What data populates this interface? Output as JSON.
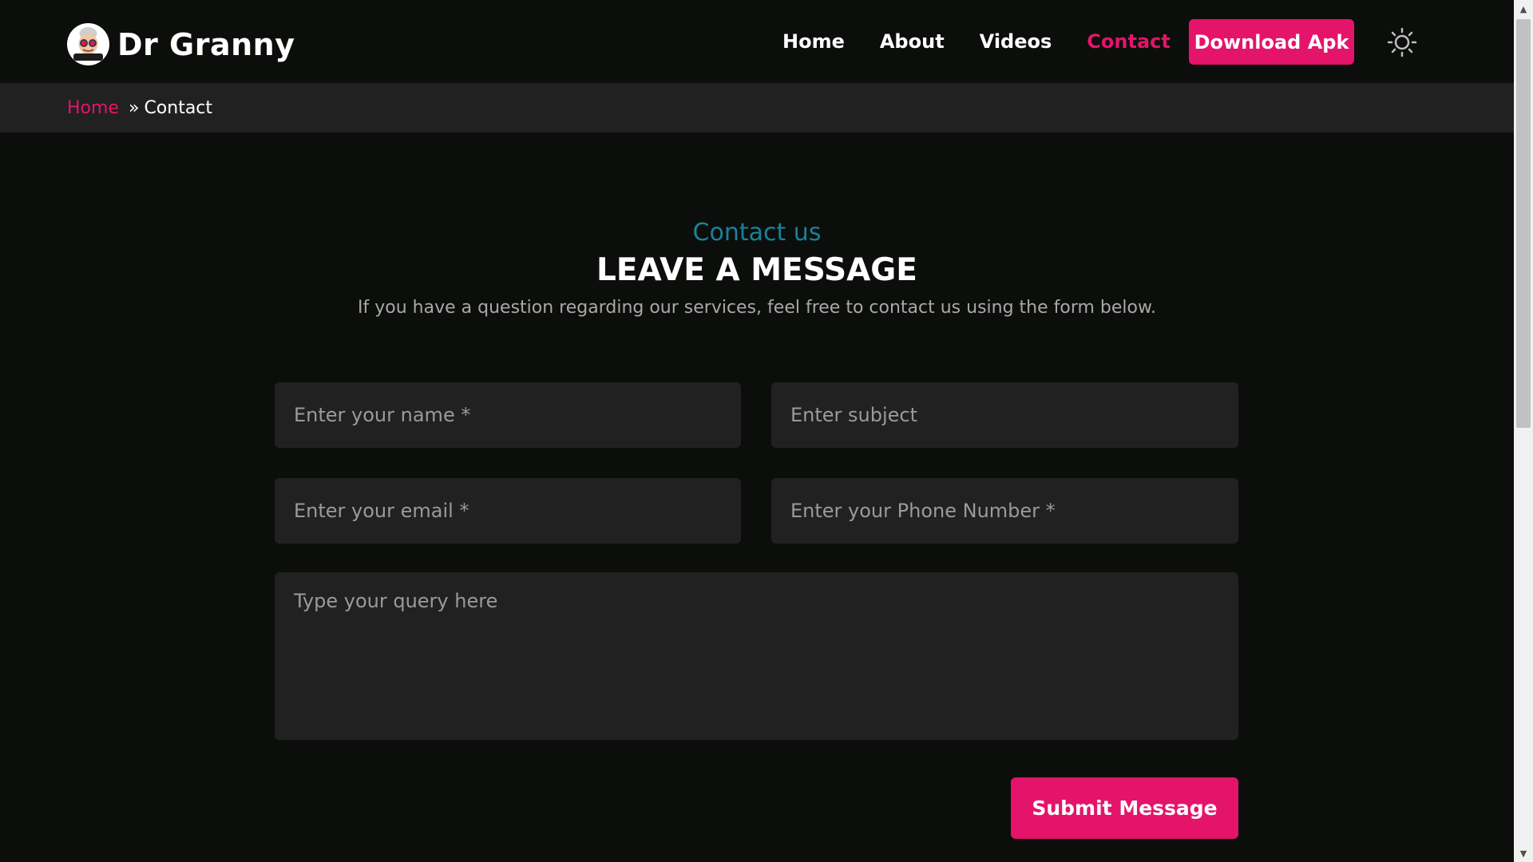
{
  "brand": {
    "name": "Dr Granny",
    "logo_icon": "granny-avatar-icon"
  },
  "nav": {
    "items": [
      {
        "label": "Home",
        "active": false
      },
      {
        "label": "About",
        "active": false
      },
      {
        "label": "Videos",
        "active": false
      },
      {
        "label": "Contact",
        "active": true
      }
    ],
    "download_label": "Download Apk",
    "theme_icon": "sun-icon"
  },
  "breadcrumb": {
    "home": "Home",
    "separator": "»",
    "current": "Contact"
  },
  "section": {
    "eyebrow": "Contact us",
    "title": "LEAVE A MESSAGE",
    "subtitle": "If you have a question regarding our services, feel free to contact us using the form below."
  },
  "form": {
    "name_placeholder": "Enter your name *",
    "subject_placeholder": "Enter subject",
    "email_placeholder": "Enter your email *",
    "phone_placeholder": "Enter your Phone Number *",
    "query_placeholder": "Type your query here",
    "submit_label": "Submit Message"
  },
  "colors": {
    "background": "#0c0e0b",
    "panel": "#212121",
    "accent": "#e4146a",
    "eyebrow": "#1a8199"
  }
}
